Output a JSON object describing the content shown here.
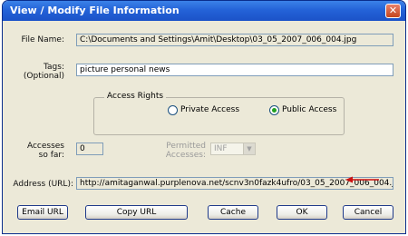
{
  "window": {
    "title": "View / Modify File Information",
    "close_glyph": "✕"
  },
  "file_name": {
    "label": "File Name:",
    "value": "C:\\Documents and Settings\\Amit\\Desktop\\03_05_2007_006_004.jpg"
  },
  "tags": {
    "label_line1": "Tags:",
    "label_line2": "(Optional)",
    "value": "picture personal news"
  },
  "access_rights": {
    "legend": "Access Rights",
    "options": [
      {
        "label": "Private Access",
        "selected": false
      },
      {
        "label": "Public Access",
        "selected": true
      }
    ]
  },
  "accesses": {
    "label_line1": "Accesses",
    "label_line2": "so far:",
    "value": "0"
  },
  "permitted": {
    "label_line1": "Permitted",
    "label_line2": "Accesses:",
    "value": "INF"
  },
  "address": {
    "label": "Address (URL):",
    "value": "http://amitaganwal.purplenova.net/scnv3n0fazk4ufro/03_05_2007_006_004.jpg"
  },
  "buttons": {
    "email_url": "Email URL",
    "copy_url": "Copy URL",
    "cache": "Cache",
    "ok": "OK",
    "cancel": "Cancel"
  },
  "colors": {
    "annotation_arrow": "#cc1111"
  },
  "icons": {
    "close": "close-icon",
    "dropdown": "chevron-down-icon"
  }
}
